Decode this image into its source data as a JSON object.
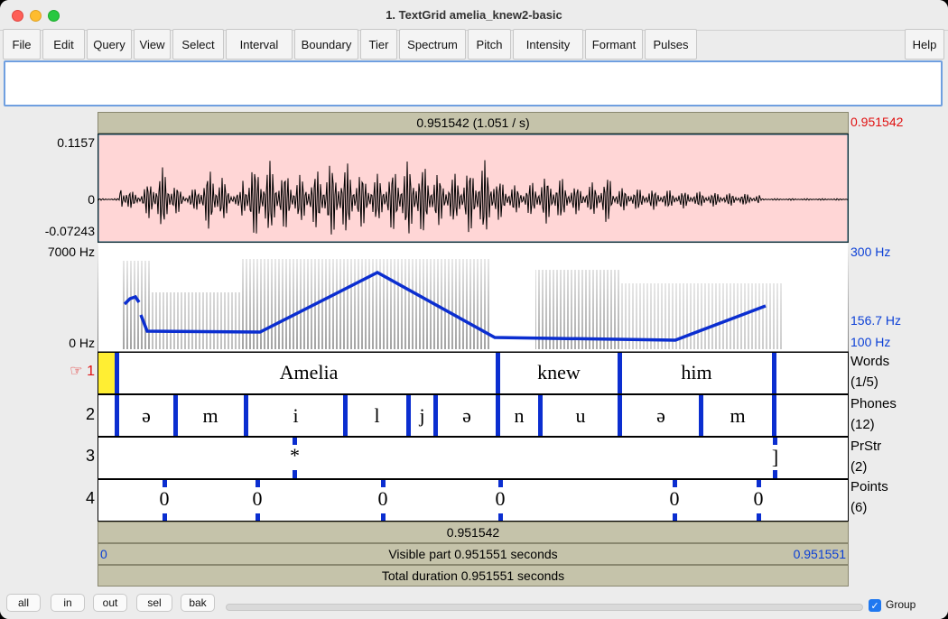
{
  "window": {
    "title": "1. TextGrid amelia_knew2-basic"
  },
  "menu": [
    "File",
    "Edit",
    "Query",
    "View",
    "Select",
    "Interval",
    "Boundary",
    "Tier",
    "Spectrum",
    "Pitch",
    "Intensity",
    "Formant",
    "Pulses"
  ],
  "help_label": "Help",
  "cursor": {
    "top_time": "0.951542 (1.051 / s)",
    "right_time": "0.951542",
    "bottom_time": "0.951542"
  },
  "waveform": {
    "max_label": "0.1157",
    "zero_label": "0",
    "min_label": "-0.07243"
  },
  "spectrogram": {
    "top_label": "7000 Hz",
    "bottom_label": "0 Hz",
    "pitch_top": "300 Hz",
    "pitch_mid": "156.7 Hz",
    "pitch_bottom": "100 Hz"
  },
  "tiers": [
    {
      "number": "1",
      "hand": "☞",
      "name": "Words",
      "count": "(1/5)",
      "intervals": [
        "Amelia",
        "knew",
        "him"
      ]
    },
    {
      "number": "2",
      "name": "Phones",
      "count": "(12)",
      "intervals": [
        "ə",
        "m",
        "i",
        "l",
        "j",
        "ə",
        "n",
        "u",
        "ə",
        "m"
      ]
    },
    {
      "number": "3",
      "name": "PrStr",
      "count": "(2)",
      "marks": [
        "*",
        "]"
      ]
    },
    {
      "number": "4",
      "name": "Points",
      "count": "(6)",
      "marks": [
        "0",
        "0",
        "0",
        "0",
        "0",
        "0"
      ]
    }
  ],
  "visible": {
    "start": "0",
    "label": "Visible part 0.951551 seconds",
    "end": "0.951551"
  },
  "total": {
    "label": "Total duration 0.951551 seconds"
  },
  "bottom_buttons": [
    "all",
    "in",
    "out",
    "sel",
    "bak"
  ],
  "group": {
    "label": "Group",
    "checked": true
  },
  "colors": {
    "accent": "#0b2ed0",
    "selection": "#ffd6d6",
    "cursor_red": "#e01010"
  }
}
